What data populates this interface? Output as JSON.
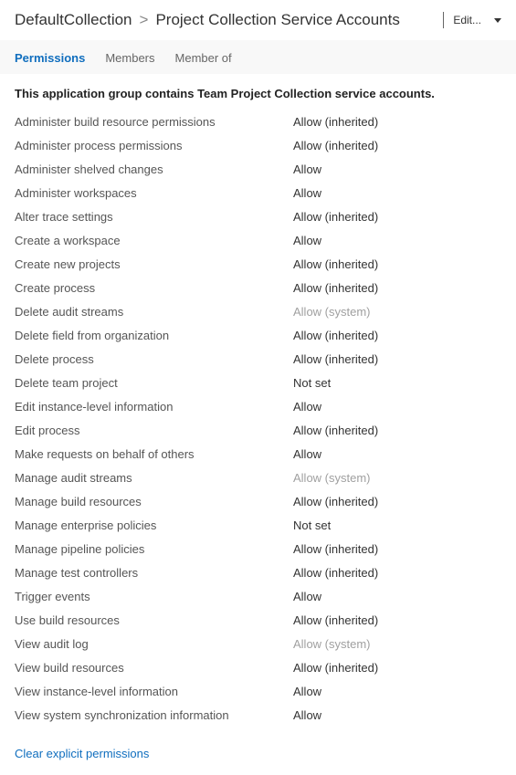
{
  "header": {
    "breadcrumb_parent": "DefaultCollection",
    "breadcrumb_sep": ">",
    "breadcrumb_current": "Project Collection Service Accounts",
    "edit_label": "Edit..."
  },
  "tabs": [
    {
      "label": "Permissions",
      "active": true
    },
    {
      "label": "Members",
      "active": false
    },
    {
      "label": "Member of",
      "active": false
    }
  ],
  "description": "This application group contains Team Project Collection service accounts.",
  "permissions": [
    {
      "label": "Administer build resource permissions",
      "value": "Allow (inherited)",
      "style": "normal"
    },
    {
      "label": "Administer process permissions",
      "value": "Allow (inherited)",
      "style": "normal"
    },
    {
      "label": "Administer shelved changes",
      "value": "Allow",
      "style": "normal"
    },
    {
      "label": "Administer workspaces",
      "value": "Allow",
      "style": "normal"
    },
    {
      "label": "Alter trace settings",
      "value": "Allow (inherited)",
      "style": "normal"
    },
    {
      "label": "Create a workspace",
      "value": "Allow",
      "style": "normal"
    },
    {
      "label": "Create new projects",
      "value": "Allow (inherited)",
      "style": "normal"
    },
    {
      "label": "Create process",
      "value": "Allow (inherited)",
      "style": "normal"
    },
    {
      "label": "Delete audit streams",
      "value": "Allow (system)",
      "style": "system"
    },
    {
      "label": "Delete field from organization",
      "value": "Allow (inherited)",
      "style": "normal"
    },
    {
      "label": "Delete process",
      "value": "Allow (inherited)",
      "style": "normal"
    },
    {
      "label": "Delete team project",
      "value": "Not set",
      "style": "notset"
    },
    {
      "label": "Edit instance-level information",
      "value": "Allow",
      "style": "normal"
    },
    {
      "label": "Edit process",
      "value": "Allow (inherited)",
      "style": "normal"
    },
    {
      "label": "Make requests on behalf of others",
      "value": "Allow",
      "style": "normal"
    },
    {
      "label": "Manage audit streams",
      "value": "Allow (system)",
      "style": "system"
    },
    {
      "label": "Manage build resources",
      "value": "Allow (inherited)",
      "style": "normal"
    },
    {
      "label": "Manage enterprise policies",
      "value": "Not set",
      "style": "notset"
    },
    {
      "label": "Manage pipeline policies",
      "value": "Allow (inherited)",
      "style": "normal"
    },
    {
      "label": "Manage test controllers",
      "value": "Allow (inherited)",
      "style": "normal"
    },
    {
      "label": "Trigger events",
      "value": "Allow",
      "style": "normal"
    },
    {
      "label": "Use build resources",
      "value": "Allow (inherited)",
      "style": "normal"
    },
    {
      "label": "View audit log",
      "value": "Allow (system)",
      "style": "system"
    },
    {
      "label": "View build resources",
      "value": "Allow (inherited)",
      "style": "normal"
    },
    {
      "label": "View instance-level information",
      "value": "Allow",
      "style": "normal"
    },
    {
      "label": "View system synchronization information",
      "value": "Allow",
      "style": "normal"
    }
  ],
  "footer": {
    "clear_link": "Clear explicit permissions"
  }
}
